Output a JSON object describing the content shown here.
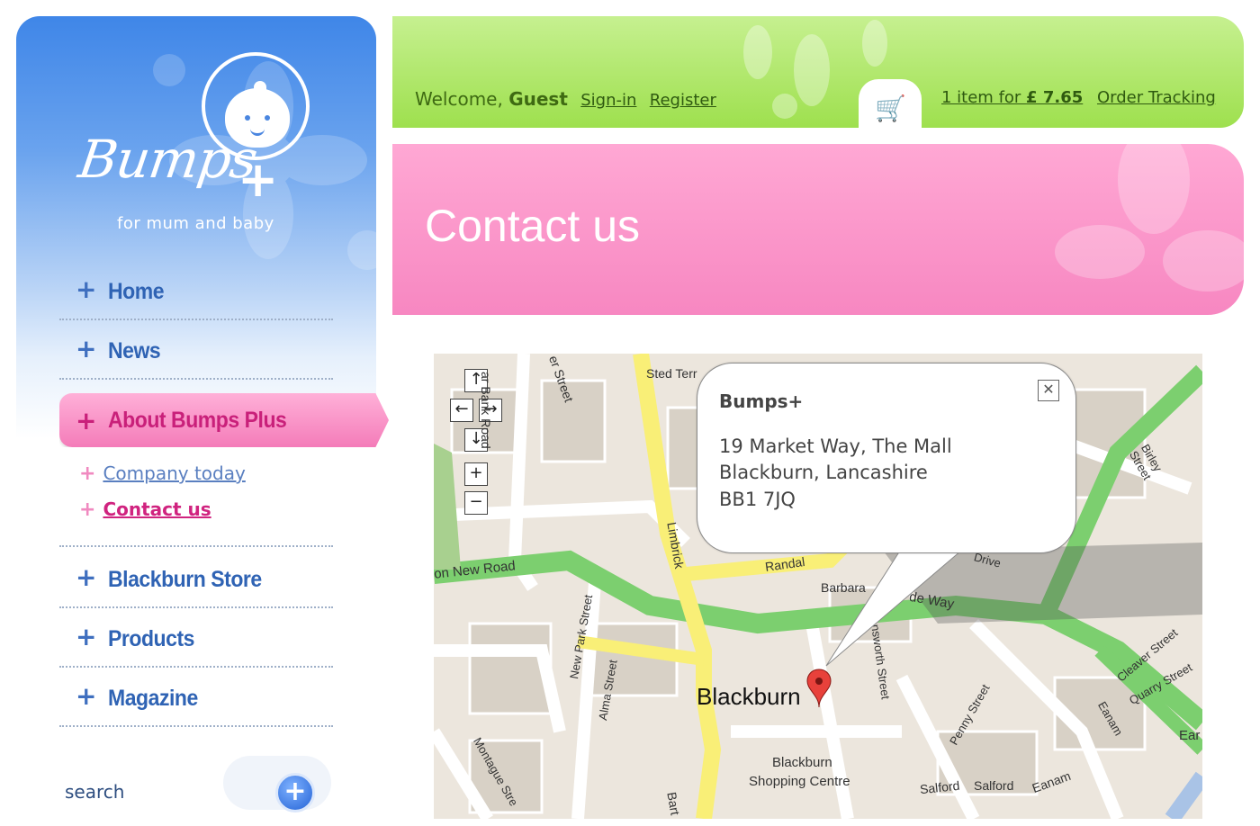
{
  "sidebar": {
    "logo_text": "Bumps",
    "logo_plus": "+",
    "tagline": "for mum and baby",
    "nav": [
      {
        "label": "Home"
      },
      {
        "label": "News"
      },
      {
        "label": "About Bumps Plus",
        "active": true
      },
      {
        "label": "Blackburn Store"
      },
      {
        "label": "Products"
      },
      {
        "label": "Magazine"
      }
    ],
    "sub_items": [
      {
        "label": "Company today"
      },
      {
        "label": "Contact us",
        "current": true
      }
    ],
    "search_label": "search",
    "search_button_icon": "plus-circle-icon"
  },
  "header": {
    "welcome_prefix": "Welcome,",
    "user": "Guest",
    "signin": "Sign-in",
    "register": "Register",
    "cart_icon": "shopping-cart-icon",
    "cart_summary_prefix": "1 item for ",
    "cart_total": "£ 7.65",
    "order_tracking": "Order Tracking"
  },
  "banner": {
    "title": "Contact us"
  },
  "map": {
    "info": {
      "title": "Bumps+",
      "address_line1": "19 Market Way, The Mall",
      "address_line2": "Blackburn, Lancashire",
      "postcode": "BB1 7JQ",
      "close_icon": "close-icon"
    },
    "controls": [
      "↑",
      "←",
      "→",
      "↓",
      "+",
      "−"
    ],
    "labels": {
      "town": "Blackburn",
      "mall1": "Blackburn",
      "mall2": "Shopping Centre",
      "new_road": "on New Road",
      "limbrick": "Limbrick",
      "randal": "Randal",
      "barbara": "Barbara",
      "way": "de Way",
      "sted": "Sted Terr",
      "new_park": "New Park Street",
      "alma": "Alma Street",
      "montague": "Montague Stre",
      "birley": "Birley Street",
      "cleaver": "Cleaver Street",
      "quarry": "Quarry Street",
      "penny": "Penny Street",
      "salford1": "Salford",
      "salford2": "Salford",
      "eanam": "Eanam",
      "drive": "Drive",
      "ainsworth": "nsworth Street",
      "er_street": "er Street",
      "ar_bank": "ar Bank Road",
      "ear": "Ear",
      "eanam2": "Eanam",
      "bart": "Bart"
    }
  },
  "colors": {
    "nav_blue": "#2f63b4",
    "active_pink": "#c9207a",
    "header_green": "#9ee04e",
    "banner_pink": "#f787c1",
    "road_green": "#7ccf6f",
    "road_yellow": "#f9ef77"
  }
}
